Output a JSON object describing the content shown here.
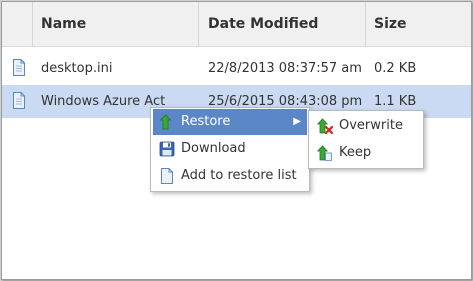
{
  "table": {
    "columns": [
      "Name",
      "Date Modified",
      "Size"
    ],
    "rows": [
      {
        "name": "desktop.ini",
        "date": "22/8/2013 08:37:57 am",
        "size": "0.2 KB",
        "selected": false
      },
      {
        "name": "Windows Azure Active Di",
        "date": "25/6/2015 08:43:08 pm",
        "size": "1.1 KB",
        "selected": true
      }
    ]
  },
  "context_menu": {
    "items": [
      {
        "label": "Restore",
        "icon": "restore-arrow-icon",
        "has_submenu": true
      },
      {
        "label": "Download",
        "icon": "floppy-disk-icon"
      },
      {
        "label": "Add to restore list",
        "icon": "document-icon"
      }
    ]
  },
  "submenu": {
    "items": [
      {
        "label": "Overwrite",
        "icon": "restore-overwrite-icon"
      },
      {
        "label": "Keep",
        "icon": "restore-keep-icon"
      }
    ]
  },
  "colors": {
    "selected_row": "#c9daf2",
    "menu_highlight": "#5b86c8",
    "arrow_green": "#39a935",
    "overwrite_red": "#d9261c"
  }
}
